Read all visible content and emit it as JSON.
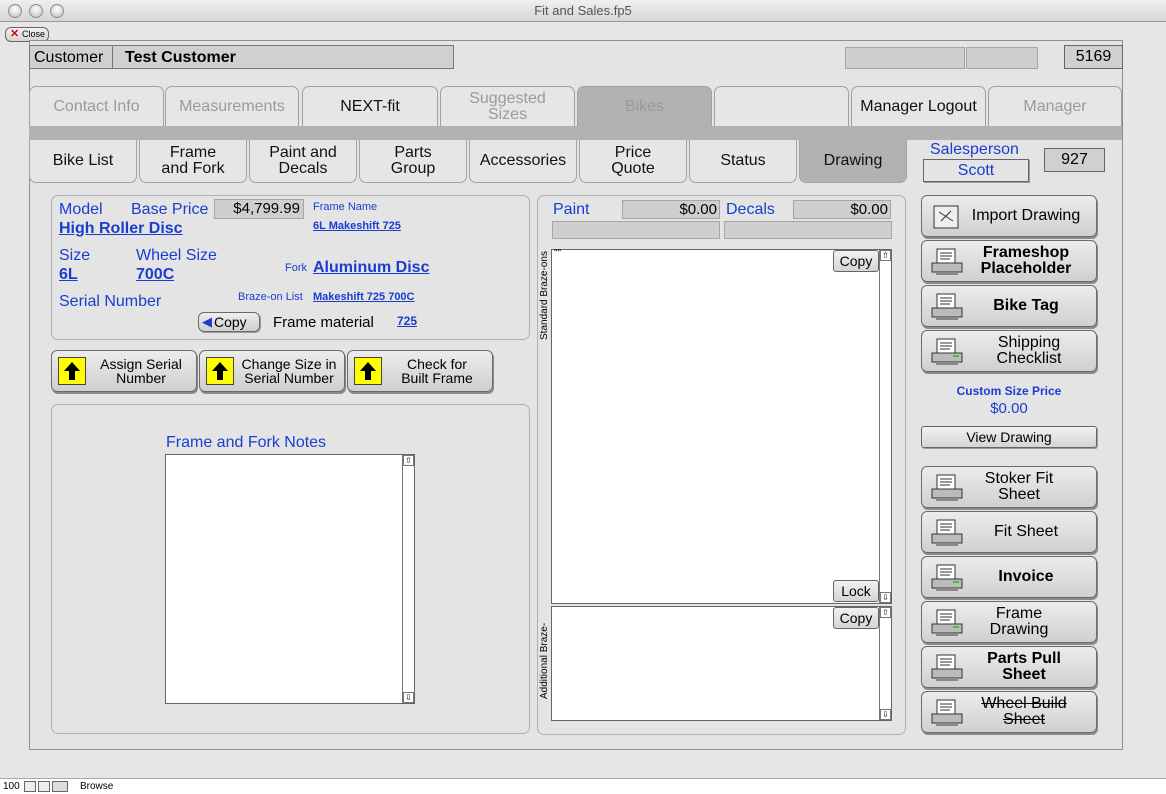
{
  "window": {
    "title": "Fit and Sales.fp5",
    "close_label": "Close"
  },
  "header": {
    "customer_label": "Customer",
    "customer_name": "Test Customer",
    "record_number": "5169"
  },
  "tabs": [
    "Contact Info",
    "Measurements",
    "NEXT-fit",
    "Suggested Sizes",
    "Bikes",
    "",
    "Manager Logout",
    "Manager"
  ],
  "subtabs": [
    "Bike List",
    "Frame and Fork",
    "Paint and Decals",
    "Parts Group",
    "Accessories",
    "Price Quote",
    "Status",
    "Drawing"
  ],
  "salesperson": {
    "label": "Salesperson",
    "name": "Scott",
    "id": "927"
  },
  "bike": {
    "model_label": "Model",
    "model_value": "High Roller Disc",
    "base_price_label": "Base Price",
    "base_price_value": "$4,799.99",
    "frame_name_label": "Frame Name",
    "frame_name_value": "6L Makeshift 725",
    "size_label": "Size",
    "size_value": "6L",
    "wheel_size_label": "Wheel Size",
    "wheel_size_value": "700C",
    "fork_label": "Fork",
    "fork_value": "Aluminum Disc",
    "serial_label": "Serial Number",
    "brazeon_label": "Braze-on List",
    "brazeon_value": "Makeshift 725 700C",
    "copy_label": "Copy",
    "frame_material_label": "Frame material",
    "frame_material_value": "725"
  },
  "actions": {
    "assign_serial": "Assign Serial Number",
    "change_size": "Change Size in Serial Number",
    "check_built": "Check for Built Frame"
  },
  "notes": {
    "label": "Frame and Fork Notes"
  },
  "paint": {
    "paint_label": "Paint",
    "paint_value": "$0.00",
    "decals_label": "Decals",
    "decals_value": "$0.00"
  },
  "brazeons": {
    "standard_label": "Standard Braze-ons",
    "standard_value": "\"\"",
    "additional_label": "Additional Braze-ons",
    "copy_label": "Copy",
    "lock_label": "Lock"
  },
  "side": {
    "import_drawing": "Import Drawing",
    "frameshop": "Frameshop Placeholder",
    "bike_tag": "Bike Tag",
    "shipping": "Shipping Checklist",
    "custom_size_price_label": "Custom Size Price",
    "custom_size_price_value": "$0.00",
    "view_drawing": "View Drawing",
    "stoker": "Stoker Fit Sheet",
    "fit_sheet": "Fit Sheet",
    "invoice": "Invoice",
    "frame_drawing": "Frame Drawing",
    "parts_pull": "Parts Pull Sheet",
    "wheel_build": "Wheel Build Sheet"
  },
  "statusbar": {
    "zoom": "100",
    "mode": "Browse"
  }
}
